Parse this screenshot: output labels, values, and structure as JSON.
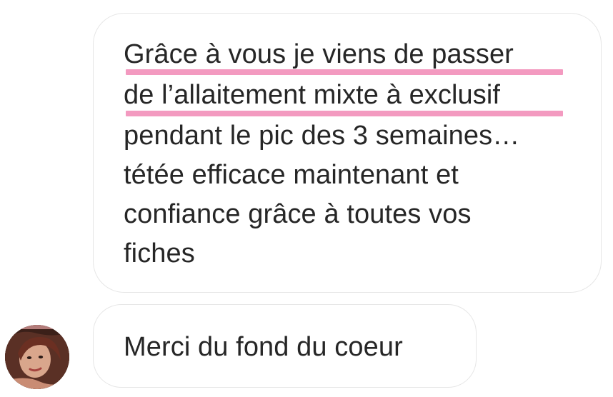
{
  "messages": {
    "main_lines": [
      "Grâce à vous je viens de passer",
      "de l’allaitement mixte à exclusif",
      "pendant le pic des 3 semaines…",
      "tétée efficace maintenant et",
      "confiance grâce à toutes vos",
      "fiches"
    ],
    "second": "Merci du fond du coeur"
  },
  "colors": {
    "highlight": "#f39ac0",
    "bubble_border": "#e6e6e6",
    "text": "#262626"
  },
  "icons": {
    "avatar": "user-avatar-photo"
  }
}
